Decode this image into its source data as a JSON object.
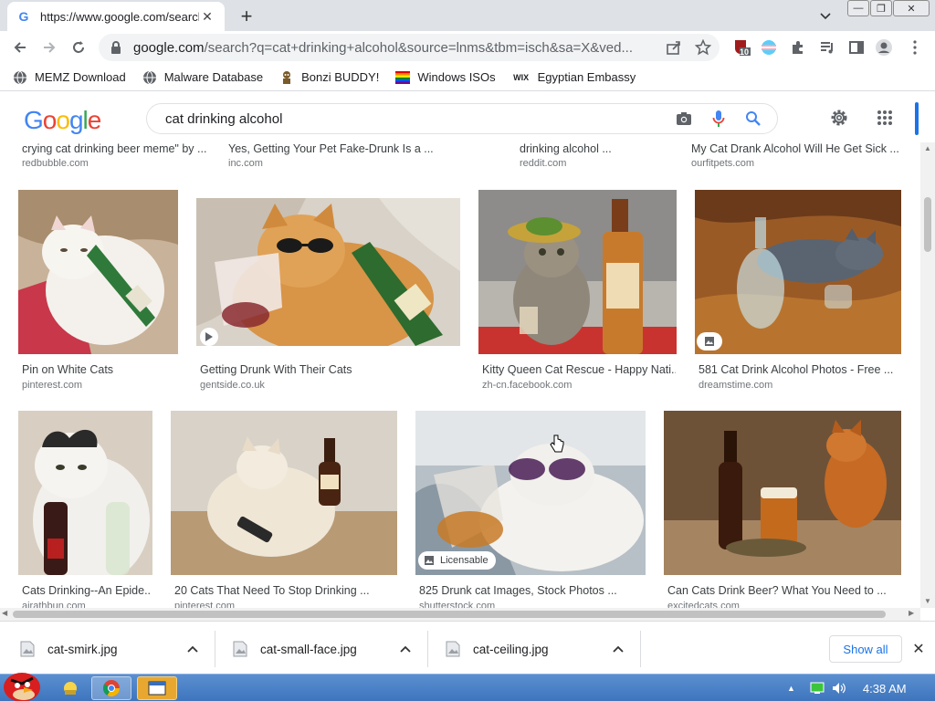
{
  "browser": {
    "tab_title": "https://www.google.com/search?q=cat+drinking+alcohol",
    "tab_favicon": "G",
    "url_host": "google.com",
    "url_rest": "/search?q=cat+drinking+alcohol&source=lnms&tbm=isch&sa=X&ved...",
    "extension_badge": "10"
  },
  "bookmarks": [
    {
      "label": "MEMZ Download",
      "icon": "globe-icon"
    },
    {
      "label": "Malware Database",
      "icon": "globe-icon"
    },
    {
      "label": "Bonzi BUDDY!",
      "icon": "bonzi-icon"
    },
    {
      "label": "Windows ISOs",
      "icon": "windows-flag-icon"
    },
    {
      "label": "Egyptian Embassy",
      "icon": "wix-icon"
    }
  ],
  "google": {
    "logo": [
      "G",
      "o",
      "o",
      "g",
      "l",
      "e"
    ],
    "logo_colors": [
      "#4285F4",
      "#EA4335",
      "#FBBC05",
      "#4285F4",
      "#34A853",
      "#EA4335"
    ],
    "query": "cat drinking alcohol"
  },
  "results_top": [
    {
      "title": "crying cat drinking beer meme\" by ...",
      "domain": "redbubble.com"
    },
    {
      "title": "Yes, Getting Your Pet Fake-Drunk Is a ...",
      "domain": "inc.com"
    },
    {
      "title": "drinking alcohol ...",
      "domain": "reddit.com"
    },
    {
      "title": "My Cat Drank Alcohol Will He Get Sick ...",
      "domain": "ourfitpets.com"
    }
  ],
  "results_row1": [
    {
      "title": "Pin on White Cats",
      "domain": "pinterest.com"
    },
    {
      "title": "Getting Drunk With Their Cats",
      "domain": "gentside.co.uk"
    },
    {
      "title": "Kitty Queen Cat Rescue - Happy Nati...",
      "domain": "zh-cn.facebook.com"
    },
    {
      "title": "581 Cat Drink Alcohol Photos - Free ...",
      "domain": "dreamstime.com"
    }
  ],
  "results_row2": [
    {
      "title": "Cats Drinking--An Epide...",
      "domain": "airathbun.com"
    },
    {
      "title": "20 Cats That Need To Stop Drinking ...",
      "domain": "pinterest.com"
    },
    {
      "title": "825 Drunk cat Images, Stock Photos ...",
      "domain": "shutterstock.com",
      "badge": "Licensable"
    },
    {
      "title": "Can Cats Drink Beer? What You Need to ...",
      "domain": "excitedcats.com"
    }
  ],
  "downloads": [
    {
      "name": "cat-smirk.jpg"
    },
    {
      "name": "cat-small-face.jpg"
    },
    {
      "name": "cat-ceiling.jpg"
    }
  ],
  "download_bar": {
    "show_all": "Show all"
  },
  "taskbar": {
    "clock": "4:38 AM"
  }
}
